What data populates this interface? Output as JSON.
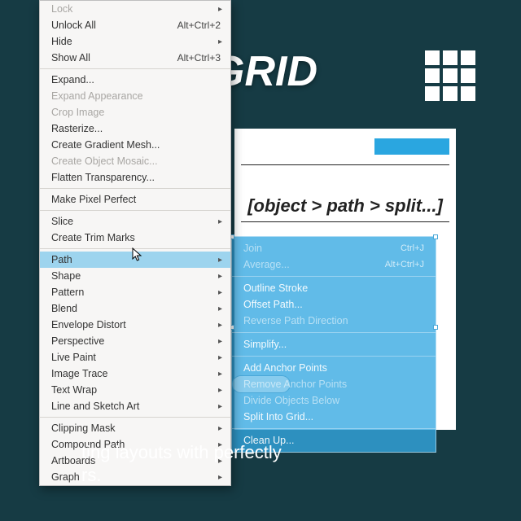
{
  "background": {
    "title_fragment": "GRID",
    "caption_line1": "ting layouts with perfectly",
    "caption_line2": "rs."
  },
  "canvas": {
    "crumb": "[object > path > split...]"
  },
  "menu": {
    "groups": [
      [
        {
          "label": "Lock",
          "arrow": true,
          "disabled": true
        },
        {
          "label": "Unlock All",
          "shortcut": "Alt+Ctrl+2"
        },
        {
          "label": "Hide",
          "arrow": true
        },
        {
          "label": "Show All",
          "shortcut": "Alt+Ctrl+3"
        }
      ],
      [
        {
          "label": "Expand..."
        },
        {
          "label": "Expand Appearance",
          "disabled": true
        },
        {
          "label": "Crop Image",
          "disabled": true
        },
        {
          "label": "Rasterize..."
        },
        {
          "label": "Create Gradient Mesh..."
        },
        {
          "label": "Create Object Mosaic...",
          "disabled": true
        },
        {
          "label": "Flatten Transparency..."
        }
      ],
      [
        {
          "label": "Make Pixel Perfect"
        }
      ],
      [
        {
          "label": "Slice",
          "arrow": true
        },
        {
          "label": "Create Trim Marks"
        }
      ],
      [
        {
          "label": "Path",
          "arrow": true,
          "highlight": true
        },
        {
          "label": "Shape",
          "arrow": true
        },
        {
          "label": "Pattern",
          "arrow": true
        },
        {
          "label": "Blend",
          "arrow": true
        },
        {
          "label": "Envelope Distort",
          "arrow": true
        },
        {
          "label": "Perspective",
          "arrow": true
        },
        {
          "label": "Live Paint",
          "arrow": true
        },
        {
          "label": "Image Trace",
          "arrow": true
        },
        {
          "label": "Text Wrap",
          "arrow": true
        },
        {
          "label": "Line and Sketch Art",
          "arrow": true
        }
      ],
      [
        {
          "label": "Clipping Mask",
          "arrow": true
        },
        {
          "label": "Compound Path",
          "arrow": true
        },
        {
          "label": "Artboards",
          "arrow": true
        },
        {
          "label": "Graph",
          "arrow": true
        }
      ]
    ]
  },
  "submenu": {
    "rows": [
      {
        "label": "Join",
        "shortcut": "Ctrl+J",
        "dim": true
      },
      {
        "label": "Average...",
        "shortcut": "Alt+Ctrl+J",
        "dim": true
      },
      {
        "sep": true
      },
      {
        "label": "Outline Stroke"
      },
      {
        "label": "Offset Path..."
      },
      {
        "label": "Reverse Path Direction",
        "dim": true
      },
      {
        "sep": true
      },
      {
        "label": "Simplify..."
      },
      {
        "sep": true
      },
      {
        "label": "Add Anchor Points"
      },
      {
        "label": "Remove Anchor Points",
        "dim": true
      },
      {
        "label": "Divide Objects Below",
        "dim": true
      },
      {
        "label": "Split Into Grid..."
      },
      {
        "sep": true
      },
      {
        "label": "Clean Up..."
      }
    ]
  }
}
